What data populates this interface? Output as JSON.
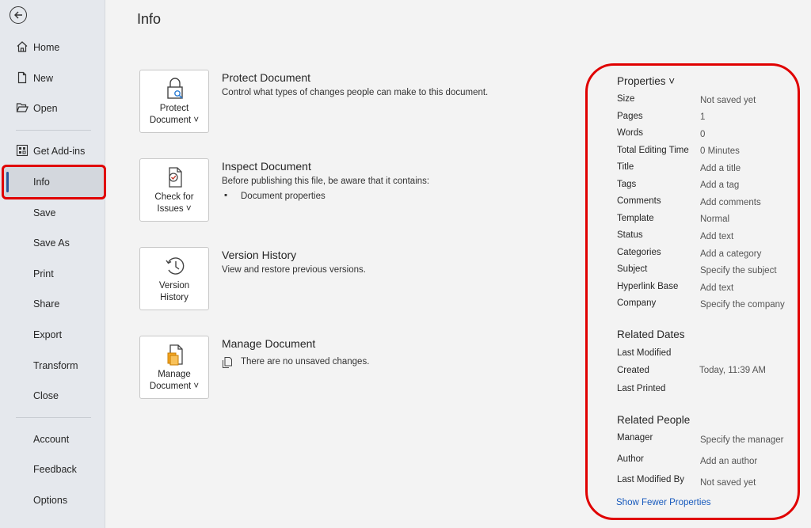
{
  "sidebar": {
    "items": [
      {
        "label": "Home"
      },
      {
        "label": "New"
      },
      {
        "label": "Open"
      },
      {
        "label": "Get Add-ins"
      },
      {
        "label": "Info"
      },
      {
        "label": "Save"
      },
      {
        "label": "Save As"
      },
      {
        "label": "Print"
      },
      {
        "label": "Share"
      },
      {
        "label": "Export"
      },
      {
        "label": "Transform"
      },
      {
        "label": "Close"
      },
      {
        "label": "Account"
      },
      {
        "label": "Feedback"
      },
      {
        "label": "Options"
      }
    ],
    "selected": "Info"
  },
  "main": {
    "title": "Info",
    "sections": [
      {
        "button_line1": "Protect",
        "button_line2": "Document ˅",
        "title": "Protect Document",
        "desc": "Control what types of changes people can make to this document.",
        "icon": "lock-icon"
      },
      {
        "button_line1": "Check for",
        "button_line2": "Issues ˅",
        "title": "Inspect Document",
        "desc": "Before publishing this file, be aware that it contains:",
        "bullet_mark": "▪",
        "bullet": "Document properties",
        "icon": "inspect-icon"
      },
      {
        "button_line1": "Version",
        "button_line2": "History",
        "title": "Version History",
        "desc": "View and restore previous versions.",
        "icon": "history-icon"
      },
      {
        "button_line1": "Manage",
        "button_line2": "Document ˅",
        "title": "Manage Document",
        "desc": "There are no unsaved changes.",
        "icon": "manage-icon"
      }
    ]
  },
  "properties": {
    "heading": "Properties ˅",
    "rows": [
      {
        "label": "Size",
        "value": "Not saved yet"
      },
      {
        "label": "Pages",
        "value": "1"
      },
      {
        "label": "Words",
        "value": "0"
      },
      {
        "label": "Total Editing Time",
        "value": "0 Minutes"
      },
      {
        "label": "Title",
        "value": "Add a title"
      },
      {
        "label": "Tags",
        "value": "Add a tag"
      },
      {
        "label": "Comments",
        "value": "Add comments"
      },
      {
        "label": "Template",
        "value": "Normal"
      },
      {
        "label": "Status",
        "value": "Add text"
      },
      {
        "label": "Categories",
        "value": "Add a category"
      },
      {
        "label": "Subject",
        "value": "Specify the subject"
      },
      {
        "label": "Hyperlink Base",
        "value": "Add text"
      },
      {
        "label": "Company",
        "value": "Specify the company"
      }
    ],
    "dates_heading": "Related Dates",
    "dates": [
      {
        "label": "Last Modified",
        "value": ""
      },
      {
        "label": "Created",
        "value": "Today, 11:39 AM"
      },
      {
        "label": "Last Printed",
        "value": ""
      }
    ],
    "people_heading": "Related People",
    "people": [
      {
        "label": "Manager",
        "value": "Specify the manager"
      },
      {
        "label": "Author",
        "value": "Add an author"
      },
      {
        "label": "Last Modified By",
        "value": "Not saved yet"
      }
    ],
    "show_fewer": "Show Fewer Properties"
  },
  "colors": {
    "highlight": "#e00000",
    "link": "#185abd",
    "sidebar_bg": "#e5e8ed"
  }
}
